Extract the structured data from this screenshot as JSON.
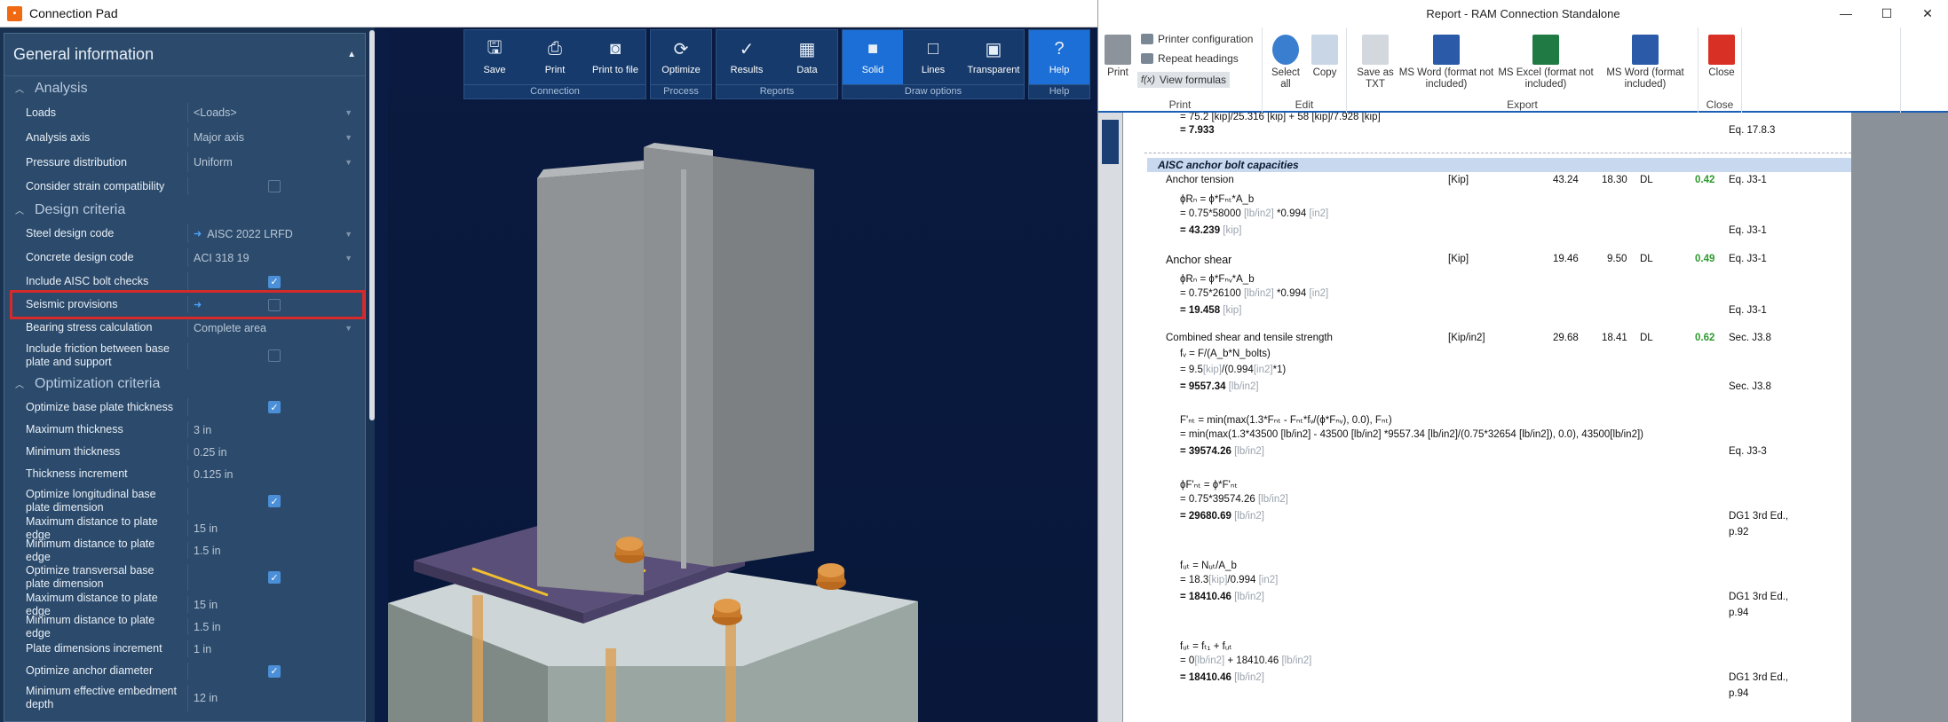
{
  "left": {
    "title": "Connection Pad",
    "panel_title": "General information",
    "sections": {
      "analysis": "Analysis",
      "design": "Design criteria",
      "optimization": "Optimization criteria"
    },
    "rows": {
      "loads": {
        "label": "Loads",
        "value": "<Loads>"
      },
      "analysis_axis": {
        "label": "Analysis axis",
        "value": "Major axis"
      },
      "pressure": {
        "label": "Pressure distribution",
        "value": "Uniform"
      },
      "strain": {
        "label": "Consider strain compatibility"
      },
      "steel_code": {
        "label": "Steel design code",
        "value": "AISC 2022 LRFD"
      },
      "concrete_code": {
        "label": "Concrete design code",
        "value": "ACI 318 19"
      },
      "aisc_bolt": {
        "label": "Include AISC bolt checks"
      },
      "seismic": {
        "label": "Seismic provisions"
      },
      "bearing": {
        "label": "Bearing stress calculation",
        "value": "Complete area"
      },
      "friction": {
        "label": "Include friction between base plate and support"
      },
      "opt_thick": {
        "label": "Optimize base plate thickness"
      },
      "max_thick": {
        "label": "Maximum thickness",
        "value": "3 in"
      },
      "min_thick": {
        "label": "Minimum thickness",
        "value": "0.25 in"
      },
      "thick_inc": {
        "label": "Thickness increment",
        "value": "0.125 in"
      },
      "opt_long": {
        "label": "Optimize longitudinal base plate dimension"
      },
      "max_dist1": {
        "label": "Maximum distance to plate edge",
        "value": "15 in"
      },
      "min_dist1": {
        "label": "Minimum distance to plate edge",
        "value": "1.5 in"
      },
      "opt_trans": {
        "label": "Optimize transversal base plate dimension"
      },
      "max_dist2": {
        "label": "Maximum distance to plate edge",
        "value": "15 in"
      },
      "min_dist2": {
        "label": "Minimum distance to plate edge",
        "value": "1.5 in"
      },
      "plate_inc": {
        "label": "Plate dimensions increment",
        "value": "1 in"
      },
      "opt_anchor": {
        "label": "Optimize anchor diameter"
      },
      "min_embed": {
        "label": "Minimum effective embedment depth",
        "value": "12 in"
      }
    },
    "toolbar": {
      "groups": {
        "connection": "Connection",
        "process": "Process",
        "reports": "Reports",
        "draw": "Draw options",
        "help": "Help"
      },
      "save": "Save",
      "print": "Print",
      "print_file": "Print to file",
      "optimize": "Optimize",
      "results": "Results",
      "data": "Data",
      "solid": "Solid",
      "lines": "Lines",
      "transparent": "Transparent",
      "help": "Help"
    }
  },
  "right": {
    "title": "Report - RAM Connection Standalone",
    "ribbon": {
      "print": "Print",
      "printer_config": "Printer configuration",
      "repeat_headings": "Repeat headings",
      "view_formulas": "View formulas",
      "select_all": "Select all",
      "copy": "Copy",
      "save_txt": "Save as TXT",
      "word_excl": "MS Word (format not included)",
      "excel_excl": "MS Excel (format not included)",
      "word_incl": "MS Word (format included)",
      "close": "Close",
      "g_print": "Print",
      "g_edit": "Edit",
      "g_export": "Export",
      "g_close": "Close"
    },
    "report": {
      "top_line": "= 75.2 [kip]/25.316 [kip] + 58 [kip]/7.928 [kip]",
      "top_result": "= 7.933",
      "top_ref": "Eq. 17.8.3",
      "section": "AISC anchor bolt capacities",
      "r1": {
        "name": "Anchor tension",
        "unit": "[Kip]",
        "cap": "43.24",
        "dem": "18.30",
        "comb": "DL",
        "ratio": "0.42",
        "ref": "Eq. J3-1"
      },
      "r1_f1": "ϕRₙ = ϕ*Fₙₜ*A_b",
      "r1_f2a": "= 0.75*58000",
      "r1_f2b": "[lb/in2]",
      "r1_f2c": "*0.994",
      "r1_f2d": "[in2]",
      "r1_f3": "= 43.239",
      "r1_f3u": "[kip]",
      "r1_ref2": "Eq. J3-1",
      "r2": {
        "name": "Anchor shear",
        "unit": "[Kip]",
        "cap": "19.46",
        "dem": "9.50",
        "comb": "DL",
        "ratio": "0.49",
        "ref": "Eq. J3-1"
      },
      "r2_f1": "ϕRₙ = ϕ*Fₙᵥ*A_b",
      "r2_f2a": "= 0.75*26100",
      "r2_f2b": "[lb/in2]",
      "r2_f2c": "*0.994",
      "r2_f2d": "[in2]",
      "r2_f3": "= 19.458",
      "r2_f3u": "[kip]",
      "r2_ref2": "Eq. J3-1",
      "r3": {
        "name": "Combined shear and tensile strength",
        "unit": "[Kip/in2]",
        "cap": "29.68",
        "dem": "18.41",
        "comb": "DL",
        "ratio": "0.62",
        "ref": "Sec. J3.8"
      },
      "r3_f1": "fᵥ = F/(A_b*N_bolts)",
      "r3_f2a": "= 9.5",
      "r3_f2b": "[kip]",
      "r3_f2c": "/(0.994",
      "r3_f2d": "[in2]",
      "r3_f2e": "*1)",
      "r3_f3": "= 9557.34",
      "r3_f3u": "[lb/in2]",
      "r3_ref2": "Sec. J3.8",
      "r3_f4": "F'ₙₜ = min(max(1.3*Fₙₜ - Fₙₜ*fᵥ/(ϕ*Fₙᵥ), 0.0), Fₙₜ)",
      "r3_f5": "= min(max(1.3*43500 [lb/in2] - 43500 [lb/in2] *9557.34 [lb/in2]/(0.75*32654 [lb/in2]), 0.0), 43500[lb/in2])",
      "r3_f6": "= 39574.26",
      "r3_f6u": "[lb/in2]",
      "r3_ref3": "Eq. J3-3",
      "r3_f7": "ϕF'ₙₜ = ϕ*F'ₙₜ",
      "r3_f8a": "= 0.75*39574.26",
      "r3_f8b": "[lb/in2]",
      "r3_f9": "= 29680.69",
      "r3_f9u": "[lb/in2]",
      "r3_ref4a": "DG1 3rd Ed.,",
      "r3_ref4b": "p.92",
      "r3_f10": "fᵤₜ = Nᵤₜ/A_b",
      "r3_f11a": "= 18.3",
      "r3_f11b": "[kip]",
      "r3_f11c": "/0.994",
      "r3_f11d": "[in2]",
      "r3_f12": "= 18410.46",
      "r3_f12u": "[lb/in2]",
      "r3_ref5a": "DG1 3rd Ed.,",
      "r3_ref5b": "p.94",
      "r3_f13": "fᵤₜ = fₜ₁ + fᵤₜ",
      "r3_f14a": "= 0",
      "r3_f14b": "[lb/in2]",
      "r3_f14c": " + 18410.46",
      "r3_f14d": "[lb/in2]",
      "r3_f15": "= 18410.46",
      "r3_f15u": "[lb/in2]",
      "r3_ref6a": "DG1 3rd Ed.,",
      "r3_ref6b": "p.94"
    }
  }
}
